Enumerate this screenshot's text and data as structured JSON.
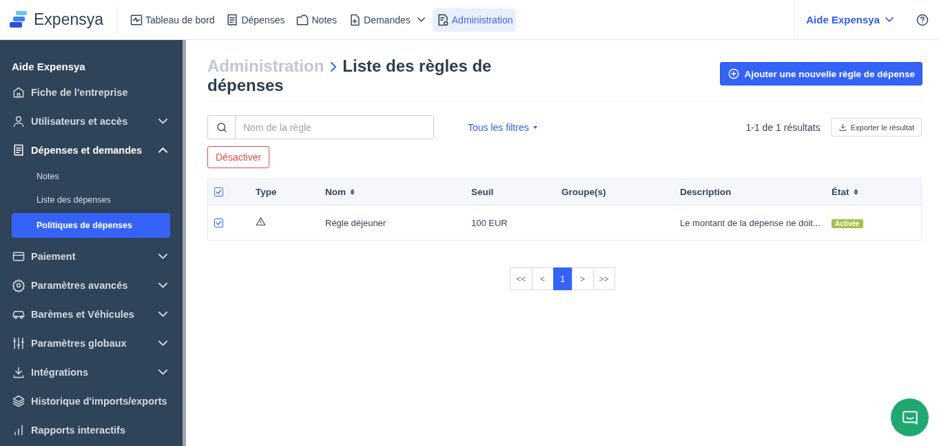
{
  "topbar": {
    "logo": "Expensya",
    "nav": [
      {
        "label": "Tableau de bord",
        "selected": false,
        "dropdown": false
      },
      {
        "label": "Dépenses",
        "selected": false,
        "dropdown": false
      },
      {
        "label": "Notes",
        "selected": false,
        "dropdown": false
      },
      {
        "label": "Demandes",
        "selected": false,
        "dropdown": true
      },
      {
        "label": "Administration",
        "selected": true,
        "dropdown": false
      }
    ],
    "user": "Aide Expensya"
  },
  "sidebar": {
    "title": "Aide Expensya",
    "items": [
      {
        "label": "Fiche de l'entreprise"
      },
      {
        "label": "Utilisateurs et accès",
        "expanded": false
      },
      {
        "label": "Dépenses et demandes",
        "expanded": true,
        "children": [
          {
            "label": "Notes",
            "selected": false
          },
          {
            "label": "Liste des dépenses",
            "selected": false
          },
          {
            "label": "Politiques de dépenses",
            "selected": true
          }
        ]
      },
      {
        "label": "Paiement",
        "expanded": false
      },
      {
        "label": "Paramètres avancés",
        "expanded": false
      },
      {
        "label": "Barèmes et Véhicules",
        "expanded": false
      },
      {
        "label": "Paramètres globaux",
        "expanded": false
      },
      {
        "label": "Intégrations",
        "expanded": false
      },
      {
        "label": "Historique d'imports/exports"
      },
      {
        "label": "Rapports interactifs"
      }
    ]
  },
  "page": {
    "breadcrumb": "Administration",
    "title": "Liste des règles de dépenses",
    "add_button": "Ajouter une nouvelle règle de dépense",
    "search": {
      "placeholder": "Nom de la règle"
    },
    "filters": "Tous les filtres",
    "results": "1-1 de 1 résultats",
    "export_button": "Exporter le résultat",
    "deactivate_button": "Désactiver"
  },
  "table": {
    "header_checked": true,
    "columns": [
      {
        "label": "Type",
        "sortable": false
      },
      {
        "label": "Nom",
        "sortable": true
      },
      {
        "label": "Seuil",
        "sortable": false
      },
      {
        "label": "Groupe(s)",
        "sortable": false
      },
      {
        "label": "Description",
        "sortable": false
      },
      {
        "label": "État",
        "sortable": true
      }
    ],
    "rows": [
      {
        "checked": true,
        "name": "Régle déjeuner",
        "threshold": "100 EUR",
        "description": "Le montant de la dépense ne doit...",
        "status": "Activée",
        "color": "#a3c04a"
      }
    ]
  },
  "pagination": [
    {
      "label": "<<",
      "selected": false
    },
    {
      "label": "<",
      "selected": false
    },
    {
      "label": "1",
      "selected": true
    },
    {
      "label": ">",
      "selected": false
    },
    {
      "label": ">>",
      "selected": false
    }
  ]
}
